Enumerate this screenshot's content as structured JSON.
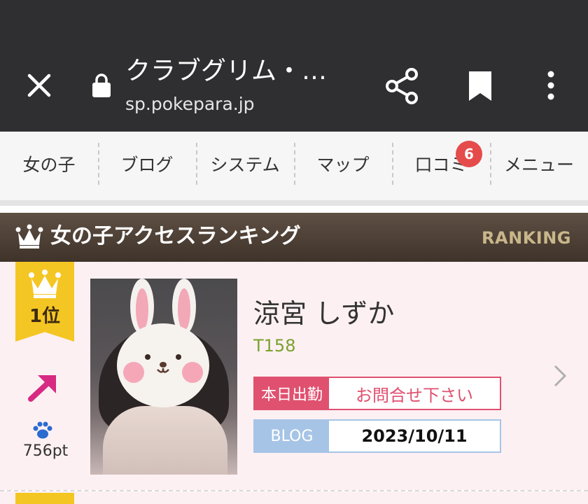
{
  "browser": {
    "title": "クラブグリム・…",
    "url": "sp.pokepara.jp"
  },
  "nav": {
    "items": [
      {
        "label": "女の子"
      },
      {
        "label": "ブログ"
      },
      {
        "label": "システム"
      },
      {
        "label": "マップ"
      },
      {
        "label": "口コミ",
        "badge": "6"
      },
      {
        "label": "メニュー"
      }
    ]
  },
  "ranking": {
    "title": "女の子アクセスランキング",
    "title_en": "RANKING",
    "entries": [
      {
        "rank": "1位",
        "trend": "up",
        "points": "756pt",
        "name": "涼宮 しずか",
        "height": "T158",
        "status_label": "本日出勤",
        "status_value": "お問合せ下さい",
        "blog_label": "BLOG",
        "blog_date": "2023/10/11"
      }
    ]
  },
  "colors": {
    "topbar": "#2f2f31",
    "header_brown": "#4f4136",
    "rank_gold": "#f4c623",
    "pink": "#e0506f",
    "blog_blue": "#a6c4e6",
    "height_green": "#7aa22d",
    "badge_red": "#e54b4b"
  }
}
